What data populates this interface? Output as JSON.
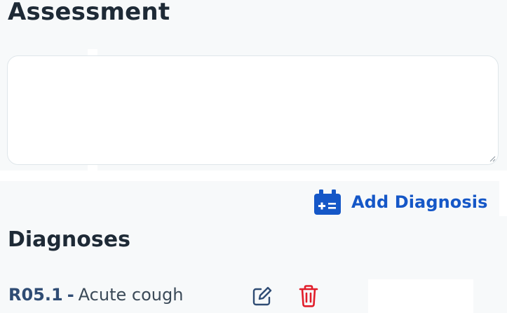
{
  "assessment": {
    "title": "Assessment",
    "textarea_value": "",
    "textarea_placeholder": ""
  },
  "actions": {
    "add_diagnosis_label": "Add Diagnosis",
    "add_diagnosis_icon": "medical-kit-icon"
  },
  "diagnoses": {
    "heading": "Diagnoses",
    "items": [
      {
        "code": "R05.1",
        "separator": "-",
        "description": "Acute cough",
        "edit_icon": "edit-icon",
        "delete_icon": "trash-icon"
      }
    ]
  },
  "colors": {
    "accent": "#1557c7",
    "code_text": "#2f4c74",
    "edit_icon": "#2f4c74",
    "delete_icon": "#e11d2a",
    "background": "#f7f9fa"
  }
}
